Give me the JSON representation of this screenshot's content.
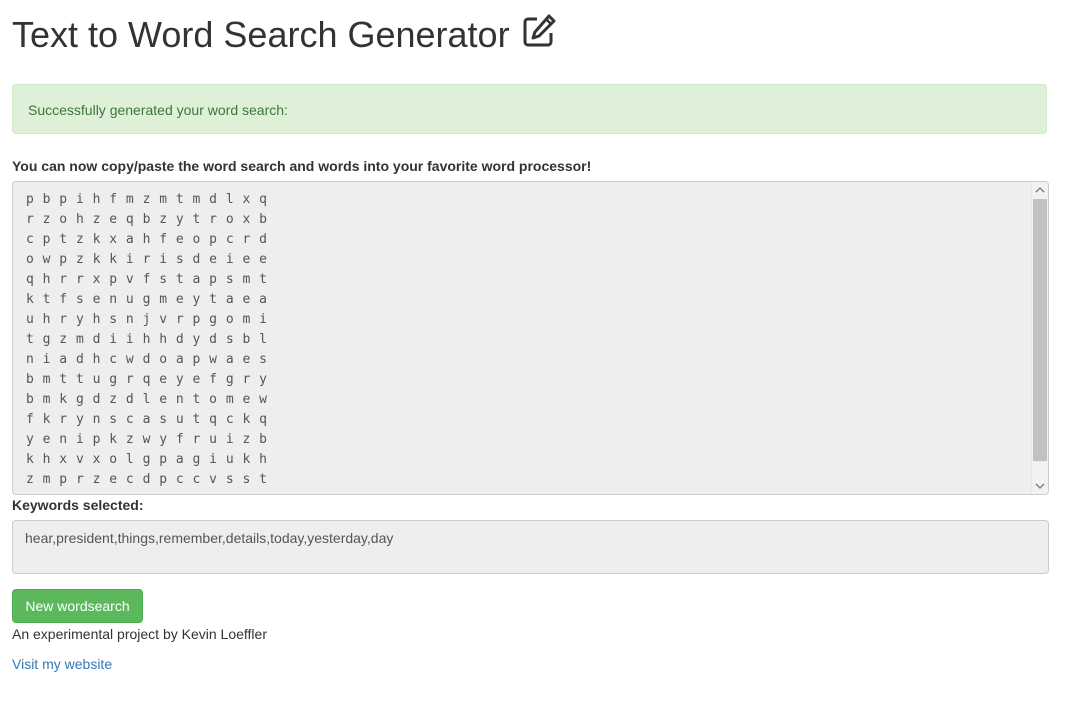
{
  "header": {
    "title": "Text to Word Search Generator",
    "title_icon": "edit-icon"
  },
  "alert": {
    "message": "Successfully generated your word search:",
    "color": "#3c763d",
    "background": "#dff0d8"
  },
  "instructions": "You can now copy/paste the word search and words into your favorite word processor!",
  "grid": {
    "rows": [
      "p b p i h f m z m t m d l x q",
      "r z o h z e q b z y t r o x b",
      "c p t z k x a h f e o p c r d",
      "o w p z k k i r i s d e i e e",
      "q h r r x p v f s t a p s m t",
      "k t f s e n u g m e y t a e a",
      "u h r y h s n j v r p g o m i",
      "t g z m d i i h h d y d s b l",
      "n i a d h c w d o a p w a e s",
      "b m t t u g r q e y e f g r y",
      "b m k g d z d l e n t o m e w",
      "f k r y n s c a s u t q c k q",
      "y e n i p k z w y f r u i z b",
      "k h x v x o l g p a g i u k h",
      "z m p r z e c d p c c v s s t"
    ]
  },
  "keywords": {
    "label": "Keywords selected:",
    "value": "hear,president,things,remember,details,today,yesterday,day"
  },
  "actions": {
    "new_button_label": "New wordsearch",
    "button_color": "#5cb85c"
  },
  "footer": {
    "credit": "An experimental project by Kevin Loeffler",
    "link_text": "Visit my website",
    "link_color": "#337ab7"
  }
}
